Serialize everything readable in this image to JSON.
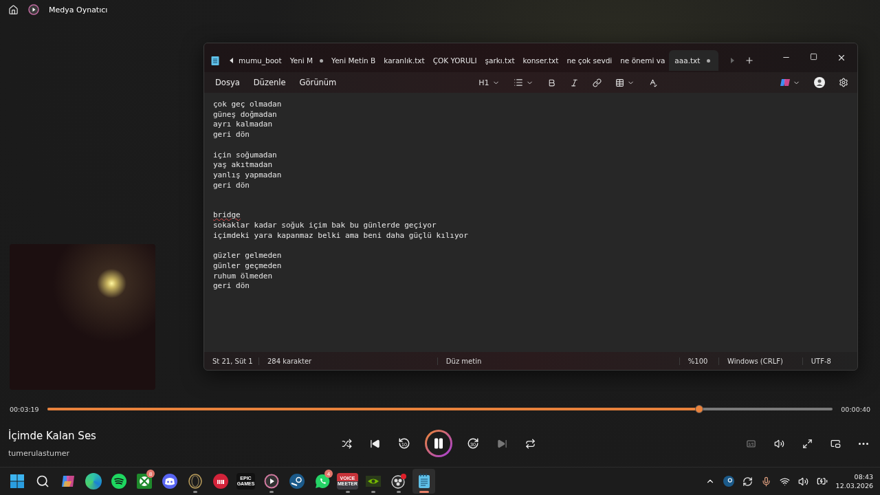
{
  "app_bar": {
    "title": "Medya Oynatıcı"
  },
  "notepad": {
    "tabs": [
      {
        "label": "mumu_boot",
        "selected": false,
        "modified": false
      },
      {
        "label": "Yeni M",
        "selected": false,
        "modified": true
      },
      {
        "label": "Yeni Metin B",
        "selected": false,
        "modified": false
      },
      {
        "label": "karanlık.txt",
        "selected": false,
        "modified": false
      },
      {
        "label": "ÇOK YORULI",
        "selected": false,
        "modified": false
      },
      {
        "label": "şarkı.txt",
        "selected": false,
        "modified": false
      },
      {
        "label": "konser.txt",
        "selected": false,
        "modified": false
      },
      {
        "label": "ne çok sevdi",
        "selected": false,
        "modified": false
      },
      {
        "label": "ne önemi va",
        "selected": false,
        "modified": false
      },
      {
        "label": "aaa.txt",
        "selected": true,
        "modified": true
      }
    ],
    "menus": [
      "Dosya",
      "Düzenle",
      "Görünüm"
    ],
    "heading_picker": "H1",
    "stanzas": [
      {
        "kind": "verse",
        "lines": [
          "çok geç olmadan",
          "güneş doğmadan",
          "ayrı kalmadan",
          "geri dön"
        ]
      },
      {
        "kind": "verse",
        "lines": [
          "için soğumadan",
          "yaş akıtmadan",
          "yanlış yapmadan",
          "geri dön"
        ]
      },
      {
        "kind": "section",
        "heading": "bridge",
        "misspelled": true,
        "lines": [
          "sokaklar kadar soğuk içim bak bu günlerde geçiyor",
          "içimdeki yara kapanmaz belki ama beni daha güçlü kılıyor"
        ]
      },
      {
        "kind": "verse",
        "lines": [
          "güzler gelmeden",
          "günler geçmeden",
          "ruhum ölmeden",
          "geri dön"
        ]
      }
    ],
    "status_bar": {
      "position": "St 21, Süt 1",
      "count": "284 karakter",
      "format": "Düz metin",
      "zoom": "%100",
      "line_endings": "Windows (CRLF)",
      "encoding": "UTF-8"
    }
  },
  "player": {
    "elapsed": "00:03:19",
    "remaining": "00:00:40",
    "level": 0.83,
    "title": "İçimde Kalan Ses",
    "artist": "tumerulastumer",
    "skip_back_label": "10",
    "skip_forward_label": "30",
    "next_disabled": true,
    "playing": true
  },
  "taskbar": {
    "apps": [
      {
        "kind": "start",
        "running": false,
        "selected": false
      },
      {
        "kind": "search",
        "running": false,
        "selected": false
      },
      {
        "kind": "copilot",
        "running": false,
        "selected": false
      },
      {
        "kind": "edge",
        "running": false,
        "selected": false
      },
      {
        "kind": "spotify",
        "running": false,
        "selected": false
      },
      {
        "kind": "xbox",
        "badge": "8",
        "running": false,
        "selected": false
      },
      {
        "kind": "discord",
        "running": false,
        "selected": false
      },
      {
        "kind": "ring",
        "running": true,
        "selected": false
      },
      {
        "kind": "riot",
        "running": false,
        "selected": false
      },
      {
        "kind": "epic",
        "label": "EPIC",
        "sublabel": "GAMES",
        "running": false,
        "selected": false
      },
      {
        "kind": "player",
        "running": true,
        "selected": false
      },
      {
        "kind": "steam",
        "running": false,
        "selected": false
      },
      {
        "kind": "whatsapp",
        "badge": "4",
        "running": false,
        "selected": false
      },
      {
        "kind": "voicemeeter",
        "label": "VOICE",
        "sublabel": "MEETER",
        "running": true,
        "selected": false
      },
      {
        "kind": "nvidia",
        "running": true,
        "selected": false
      },
      {
        "kind": "obs",
        "running": true,
        "selected": false
      },
      {
        "kind": "notepad",
        "running": true,
        "selected": true
      }
    ],
    "time": "08:43",
    "date": "12.03.2026"
  }
}
